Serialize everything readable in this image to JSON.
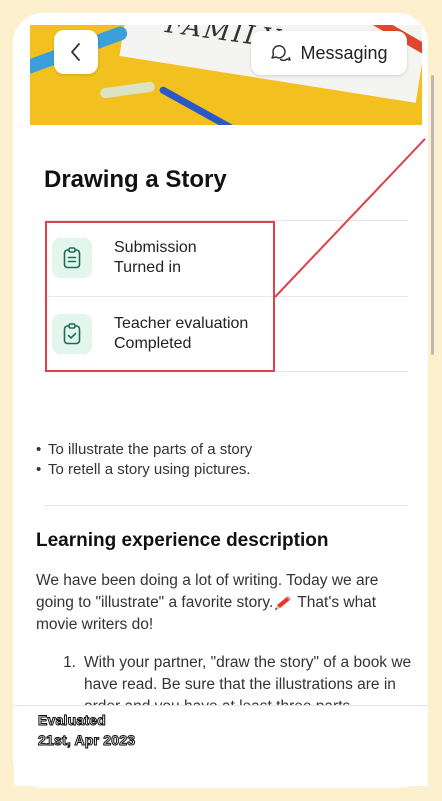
{
  "header": {
    "back_icon": "chevron-left-icon",
    "messaging_label": "Messaging",
    "messaging_icon": "chat-bubbles-icon",
    "hero_scribble": "FAMILY"
  },
  "assignment": {
    "title": "Drawing a Story"
  },
  "status": [
    {
      "title": "Submission",
      "value": "Turned in",
      "icon": "clipboard-icon"
    },
    {
      "title": "Teacher evaluation",
      "value": "Completed",
      "icon": "clipboard-check-icon"
    }
  ],
  "objectives": [
    "To illustrate the parts of a story",
    "To retell a story using pictures."
  ],
  "description": {
    "heading": "Learning experience description",
    "text_before": "We have been doing a lot of writing. Today we are going to \"illustrate\" a favorite story.",
    "text_after": " That's what movie writers do!",
    "steps": [
      {
        "number": "1.",
        "text": "With your partner, \"draw the story\" of a book we have read. Be sure that the illustrations are in order and you have at least three parts (beginning,middle,end)"
      }
    ]
  },
  "footer": {
    "status": "Evaluated",
    "date": "21st, Apr 2023"
  },
  "colors": {
    "background": "#fdf0cf",
    "highlight": "#e0404e",
    "icon_bg": "#e2f6ee",
    "icon_stroke": "#1f6b55"
  }
}
